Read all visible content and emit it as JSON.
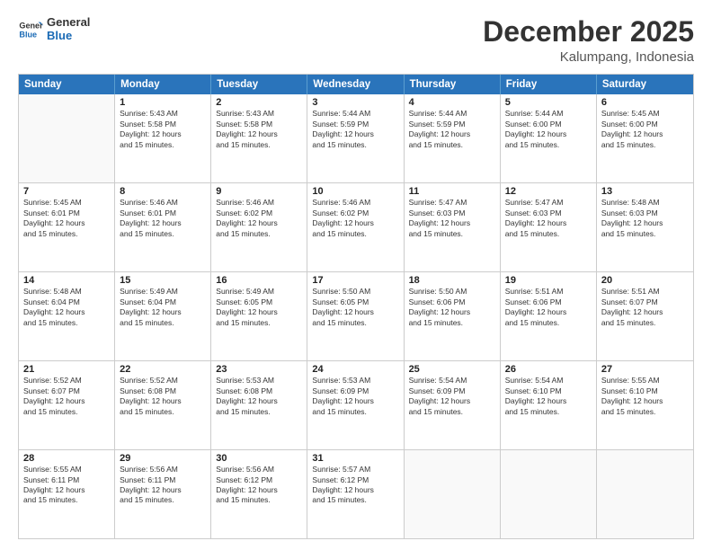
{
  "logo": {
    "line1": "General",
    "line2": "Blue"
  },
  "title": "December 2025",
  "subtitle": "Kalumpang, Indonesia",
  "header_days": [
    "Sunday",
    "Monday",
    "Tuesday",
    "Wednesday",
    "Thursday",
    "Friday",
    "Saturday"
  ],
  "weeks": [
    [
      {
        "day": "",
        "empty": true
      },
      {
        "day": "1",
        "sunrise": "5:43 AM",
        "sunset": "5:58 PM",
        "daylight": "12 hours and 15 minutes."
      },
      {
        "day": "2",
        "sunrise": "5:43 AM",
        "sunset": "5:58 PM",
        "daylight": "12 hours and 15 minutes."
      },
      {
        "day": "3",
        "sunrise": "5:44 AM",
        "sunset": "5:59 PM",
        "daylight": "12 hours and 15 minutes."
      },
      {
        "day": "4",
        "sunrise": "5:44 AM",
        "sunset": "5:59 PM",
        "daylight": "12 hours and 15 minutes."
      },
      {
        "day": "5",
        "sunrise": "5:44 AM",
        "sunset": "6:00 PM",
        "daylight": "12 hours and 15 minutes."
      },
      {
        "day": "6",
        "sunrise": "5:45 AM",
        "sunset": "6:00 PM",
        "daylight": "12 hours and 15 minutes."
      }
    ],
    [
      {
        "day": "7",
        "sunrise": "5:45 AM",
        "sunset": "6:01 PM",
        "daylight": "12 hours and 15 minutes."
      },
      {
        "day": "8",
        "sunrise": "5:46 AM",
        "sunset": "6:01 PM",
        "daylight": "12 hours and 15 minutes."
      },
      {
        "day": "9",
        "sunrise": "5:46 AM",
        "sunset": "6:02 PM",
        "daylight": "12 hours and 15 minutes."
      },
      {
        "day": "10",
        "sunrise": "5:46 AM",
        "sunset": "6:02 PM",
        "daylight": "12 hours and 15 minutes."
      },
      {
        "day": "11",
        "sunrise": "5:47 AM",
        "sunset": "6:03 PM",
        "daylight": "12 hours and 15 minutes."
      },
      {
        "day": "12",
        "sunrise": "5:47 AM",
        "sunset": "6:03 PM",
        "daylight": "12 hours and 15 minutes."
      },
      {
        "day": "13",
        "sunrise": "5:48 AM",
        "sunset": "6:03 PM",
        "daylight": "12 hours and 15 minutes."
      }
    ],
    [
      {
        "day": "14",
        "sunrise": "5:48 AM",
        "sunset": "6:04 PM",
        "daylight": "12 hours and 15 minutes."
      },
      {
        "day": "15",
        "sunrise": "5:49 AM",
        "sunset": "6:04 PM",
        "daylight": "12 hours and 15 minutes."
      },
      {
        "day": "16",
        "sunrise": "5:49 AM",
        "sunset": "6:05 PM",
        "daylight": "12 hours and 15 minutes."
      },
      {
        "day": "17",
        "sunrise": "5:50 AM",
        "sunset": "6:05 PM",
        "daylight": "12 hours and 15 minutes."
      },
      {
        "day": "18",
        "sunrise": "5:50 AM",
        "sunset": "6:06 PM",
        "daylight": "12 hours and 15 minutes."
      },
      {
        "day": "19",
        "sunrise": "5:51 AM",
        "sunset": "6:06 PM",
        "daylight": "12 hours and 15 minutes."
      },
      {
        "day": "20",
        "sunrise": "5:51 AM",
        "sunset": "6:07 PM",
        "daylight": "12 hours and 15 minutes."
      }
    ],
    [
      {
        "day": "21",
        "sunrise": "5:52 AM",
        "sunset": "6:07 PM",
        "daylight": "12 hours and 15 minutes."
      },
      {
        "day": "22",
        "sunrise": "5:52 AM",
        "sunset": "6:08 PM",
        "daylight": "12 hours and 15 minutes."
      },
      {
        "day": "23",
        "sunrise": "5:53 AM",
        "sunset": "6:08 PM",
        "daylight": "12 hours and 15 minutes."
      },
      {
        "day": "24",
        "sunrise": "5:53 AM",
        "sunset": "6:09 PM",
        "daylight": "12 hours and 15 minutes."
      },
      {
        "day": "25",
        "sunrise": "5:54 AM",
        "sunset": "6:09 PM",
        "daylight": "12 hours and 15 minutes."
      },
      {
        "day": "26",
        "sunrise": "5:54 AM",
        "sunset": "6:10 PM",
        "daylight": "12 hours and 15 minutes."
      },
      {
        "day": "27",
        "sunrise": "5:55 AM",
        "sunset": "6:10 PM",
        "daylight": "12 hours and 15 minutes."
      }
    ],
    [
      {
        "day": "28",
        "sunrise": "5:55 AM",
        "sunset": "6:11 PM",
        "daylight": "12 hours and 15 minutes."
      },
      {
        "day": "29",
        "sunrise": "5:56 AM",
        "sunset": "6:11 PM",
        "daylight": "12 hours and 15 minutes."
      },
      {
        "day": "30",
        "sunrise": "5:56 AM",
        "sunset": "6:12 PM",
        "daylight": "12 hours and 15 minutes."
      },
      {
        "day": "31",
        "sunrise": "5:57 AM",
        "sunset": "6:12 PM",
        "daylight": "12 hours and 15 minutes."
      },
      {
        "day": "",
        "empty": true
      },
      {
        "day": "",
        "empty": true
      },
      {
        "day": "",
        "empty": true
      }
    ]
  ]
}
